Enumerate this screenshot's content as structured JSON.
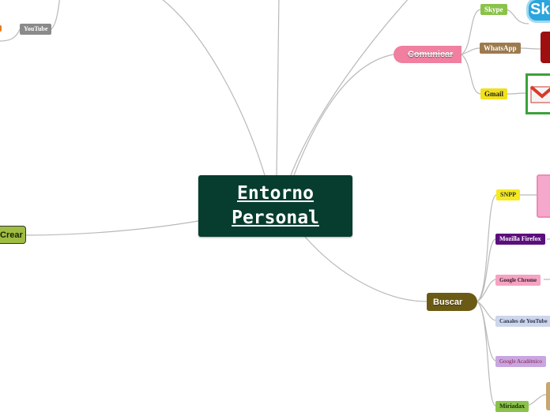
{
  "central": {
    "line1": "Entorno",
    "line2": "Personal"
  },
  "branches": {
    "comunicar": "Comunicar",
    "buscar": "Buscar",
    "crear": "Crear"
  },
  "comunicar_items": {
    "skype": "Skype",
    "whatsapp": "WhatsApp",
    "gmail": "Gmail"
  },
  "crear_items": {
    "youtube": "YouTube"
  },
  "buscar_items": {
    "snpp": "SNPP",
    "firefox": "Mozilla Firefox",
    "chrome": "Google Chrome",
    "canales": "Canales de YouTube",
    "academico": "Google Académico",
    "miriadax": "Miriadax"
  },
  "logos": {
    "skype_text": "Sk"
  },
  "colors": {
    "central": "#063d2e",
    "comunicar": "#f07fa0",
    "buscar": "#6b5a13",
    "crear": "#9ebd42",
    "connector": "#b9b9b9"
  }
}
